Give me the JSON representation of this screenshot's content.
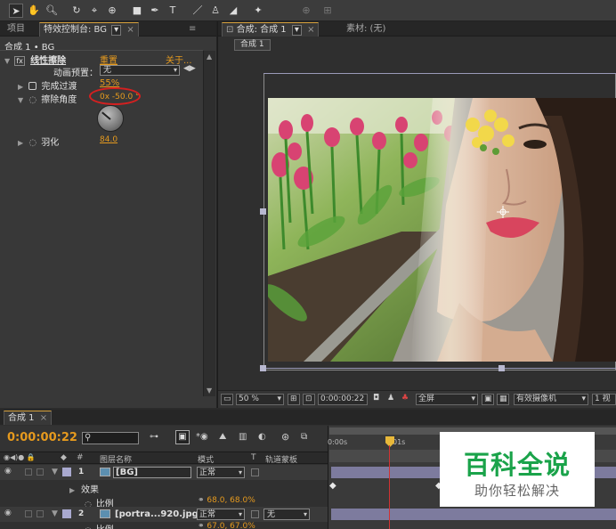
{
  "toolbar": {
    "tools": [
      "selection-tool",
      "hand-tool",
      "zoom-tool",
      "rotate-tool",
      "camera-tool",
      "pan-behind-tool",
      "rectangle-tool",
      "pen-tool",
      "text-tool",
      "brush-tool",
      "clone-stamp-tool",
      "eraser-tool",
      "roto-brush-tool"
    ]
  },
  "left_panel": {
    "tab_project": "项目",
    "tab_effect_controls": "特效控制台: BG",
    "breadcrumb": "合成 1 • BG",
    "effect_name": "线性擦除",
    "reset_label": "重置",
    "about_label": "关于...",
    "preset_label": "动画预置：",
    "preset_value": "无",
    "completion_label": "完成过渡",
    "completion_value": "55%",
    "angle_label": "擦除角度",
    "angle_value": "0x -50.0 °",
    "feather_label": "羽化",
    "feather_value": "84.0"
  },
  "comp_panel": {
    "tab_comp": "合成: 合成 1",
    "tab_footage": "素材: (无)",
    "comp_chip": "合成 1",
    "zoom": "50 %",
    "timecode": "0:00:00:22",
    "resolution": "全屏",
    "camera": "有效摄像机",
    "view_count": "1 视"
  },
  "timeline": {
    "tab": "合成 1",
    "timecode": "0:00:00:22",
    "col_num": "#",
    "col_source": "图层名称",
    "col_mode": "模式",
    "col_t": "T",
    "col_trkmat": "轨道蒙板",
    "ruler_start": "0:00s",
    "ruler_mid": "01s",
    "layers": [
      {
        "num": "1",
        "name": "[BG]",
        "mode": "正常",
        "sub_effects": "效果",
        "scale_label": "比例",
        "scale_value": "68.0, 68.0%"
      },
      {
        "num": "2",
        "name": "[portra...920.jpg]",
        "mode": "正常",
        "trkmat": "无",
        "scale_label": "比例",
        "scale_value": "67.0, 67.0%"
      }
    ]
  },
  "watermark": {
    "title": "百科全说",
    "subtitle": "助你轻松解决"
  },
  "colors": {
    "accent_orange": "#e69a1e",
    "playhead_red": "#d23232",
    "layer_bar": "#7d7b9e",
    "watermark_green": "#1aa34a"
  }
}
